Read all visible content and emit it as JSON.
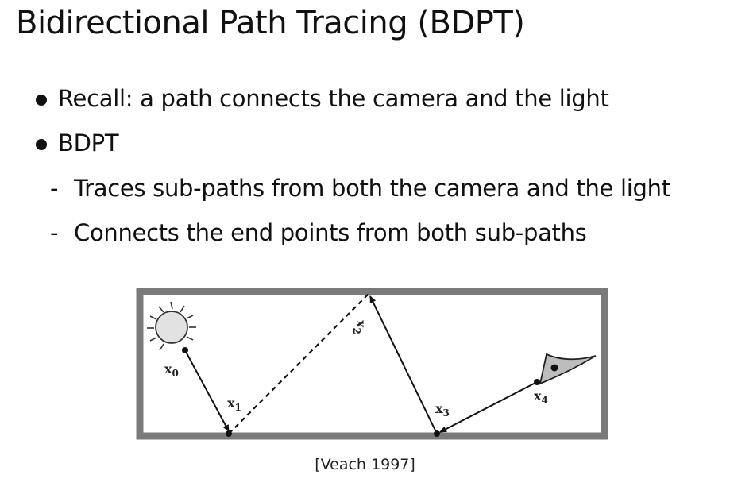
{
  "slide": {
    "title": "Bidirectional Path Tracing (BDPT)",
    "bullets": [
      "Recall: a path connects the camera and the light",
      "BDPT"
    ],
    "sub_bullets": [
      "Traces sub-paths from both the camera and the light",
      "Connects the end points from both sub-paths"
    ],
    "dash_glyph": "-",
    "caption": "[Veach 1997]"
  },
  "diagram": {
    "labels": {
      "x0": "x",
      "x0_sub": "0",
      "x1": "x",
      "x1_sub": "1",
      "x2": "x",
      "x2_sub": "2",
      "x3": "x",
      "x3_sub": "3",
      "x4": "x",
      "x4_sub": "4"
    },
    "colors": {
      "box": "#7a7a7a",
      "light_fill": "#e2e2e2",
      "eye_fill": "#bdbdbd",
      "path": "#111111"
    }
  }
}
